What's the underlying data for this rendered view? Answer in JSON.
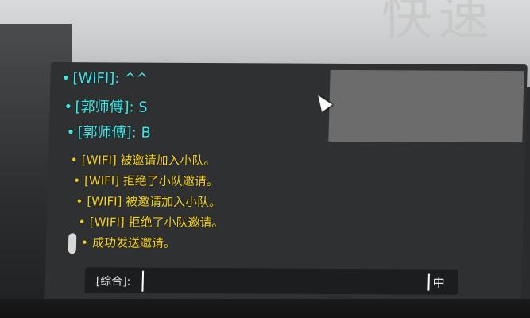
{
  "background": {
    "decor_text": "快速加"
  },
  "chat": {
    "messages": [
      {
        "text": "[WIFI]: ^^",
        "color": "#3ee6e8",
        "channel": "chat"
      },
      {
        "text": "[郭师傅]: S",
        "color": "#3ee6e8",
        "channel": "chat"
      },
      {
        "text": "[郭师傅]: B",
        "color": "#3ee6e8",
        "channel": "chat"
      },
      {
        "text": "[WIFI] 被邀请加入小队。",
        "color": "#f5d21a",
        "channel": "system"
      },
      {
        "text": "[WIFI] 拒绝了小队邀请。",
        "color": "#f5d21a",
        "channel": "system"
      },
      {
        "text": "[WIFI] 被邀请加入小队。",
        "color": "#f5d21a",
        "channel": "system"
      },
      {
        "text": "[WIFI] 拒绝了小队邀请。",
        "color": "#f5d21a",
        "channel": "system"
      },
      {
        "text": "成功发送邀请。",
        "color": "#f5d21a",
        "channel": "system"
      }
    ],
    "bullet": "•",
    "input": {
      "channel_label": "[综合]:",
      "value": "",
      "ime_label": "中"
    }
  }
}
